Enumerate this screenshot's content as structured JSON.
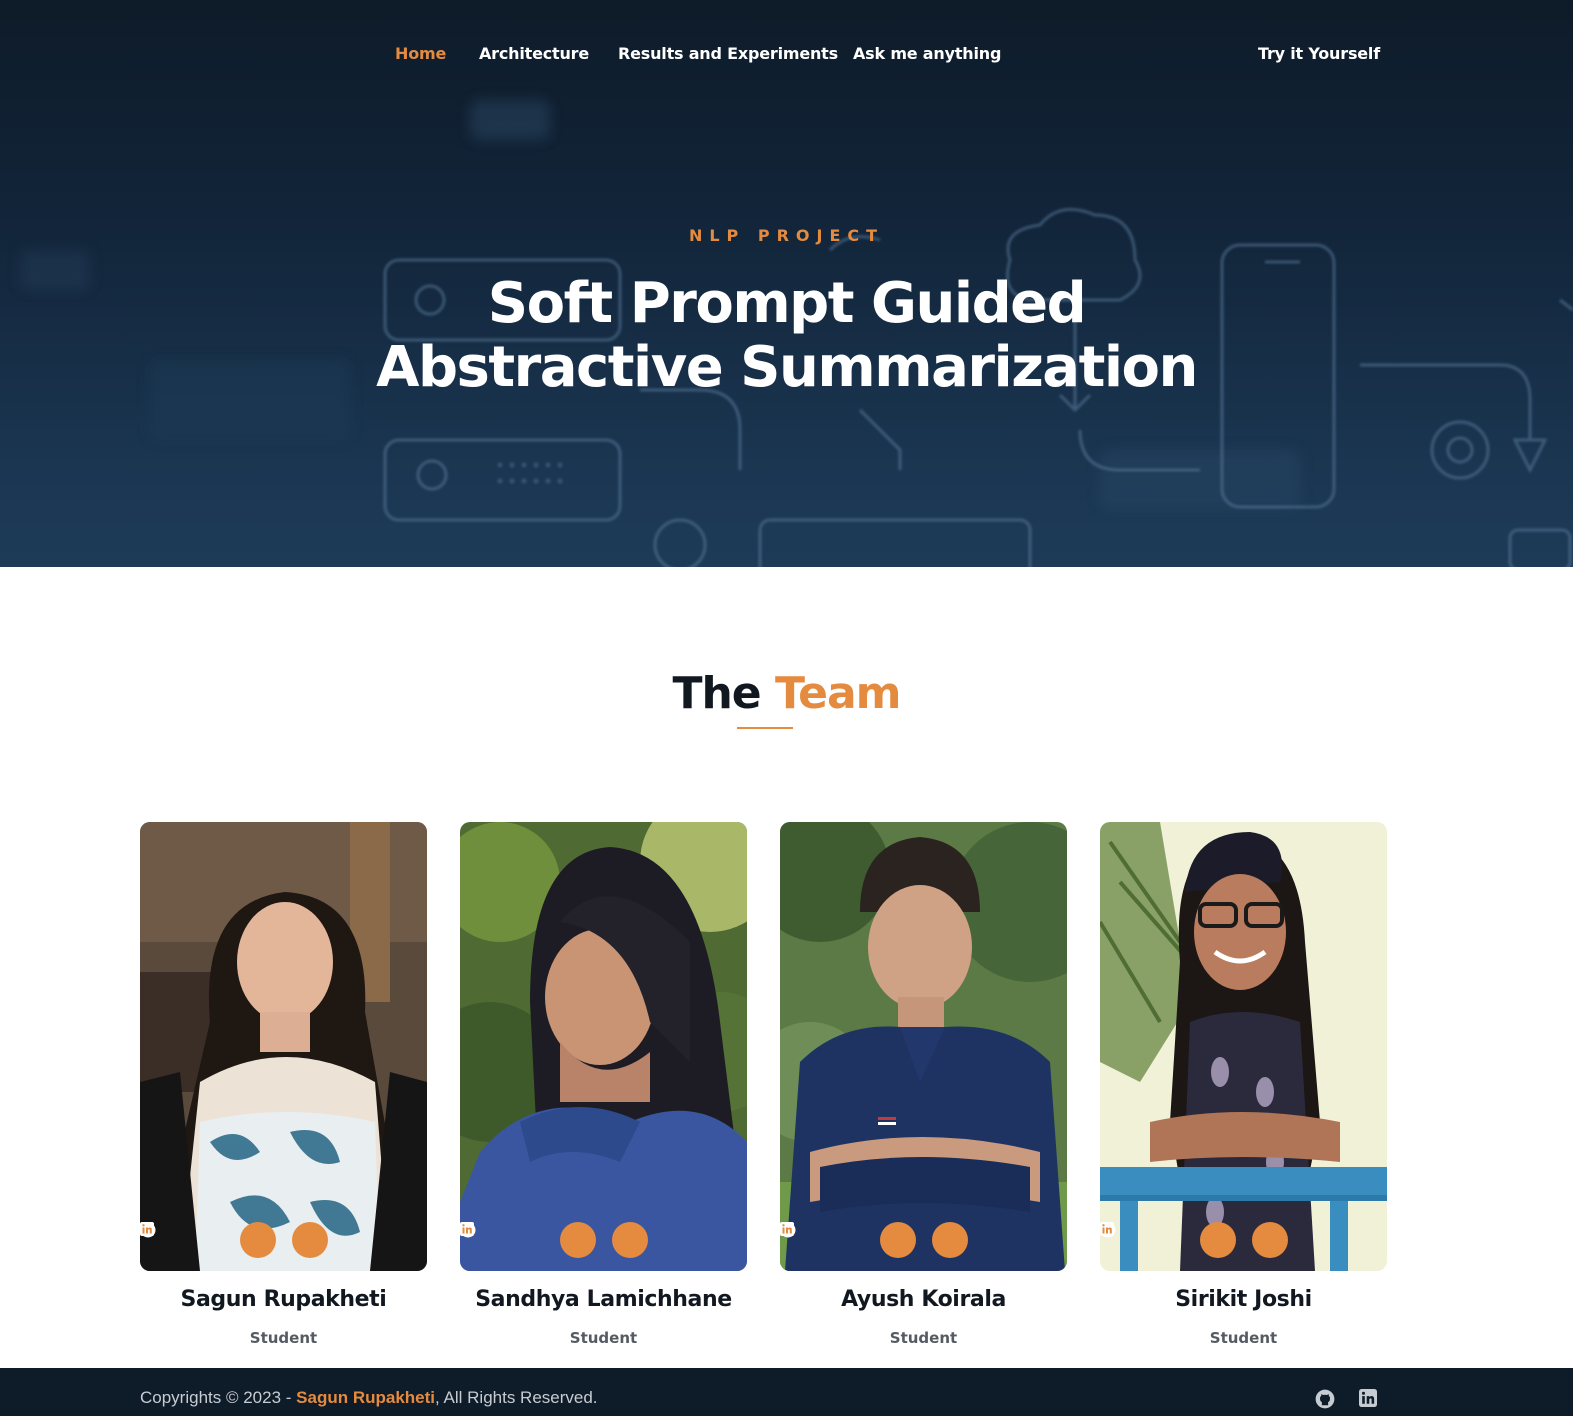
{
  "nav": {
    "items": [
      {
        "label": "Home",
        "active": true
      },
      {
        "label": "Architecture",
        "active": false
      },
      {
        "label": "Results and Experiments",
        "active": false
      },
      {
        "label": "Ask me anything",
        "active": false
      }
    ],
    "cta_label": "Try it Yourself"
  },
  "hero": {
    "kicker": "NLP PROJECT",
    "title_line1": "Soft Prompt Guided",
    "title_line2": "Abstractive Summarization"
  },
  "team": {
    "heading_plain": "The",
    "heading_accent": "Team",
    "members": [
      {
        "name": "Sagun Rupakheti",
        "role": "Student",
        "icons": [
          "github-icon",
          "linkedin-icon"
        ]
      },
      {
        "name": "Sandhya Lamichhane",
        "role": "Student",
        "icons": [
          "github-icon",
          "linkedin-icon"
        ]
      },
      {
        "name": "Ayush Koirala",
        "role": "Student",
        "icons": [
          "github-icon",
          "linkedin-icon"
        ]
      },
      {
        "name": "Sirikit Joshi",
        "role": "Student",
        "icons": [
          "github-icon",
          "linkedin-icon"
        ]
      }
    ]
  },
  "footer": {
    "copyright_prefix": "Copyrights © 2023 - ",
    "author": "Sagun Rupakheti",
    "copyright_suffix": ", All Rights Reserved.",
    "icons": [
      "github-icon",
      "linkedin-icon"
    ]
  },
  "colors": {
    "accent": "#e58b3f",
    "hero_dark": "#0e1b29",
    "footer_bg": "#0e1b29",
    "text_dark": "#111820"
  }
}
